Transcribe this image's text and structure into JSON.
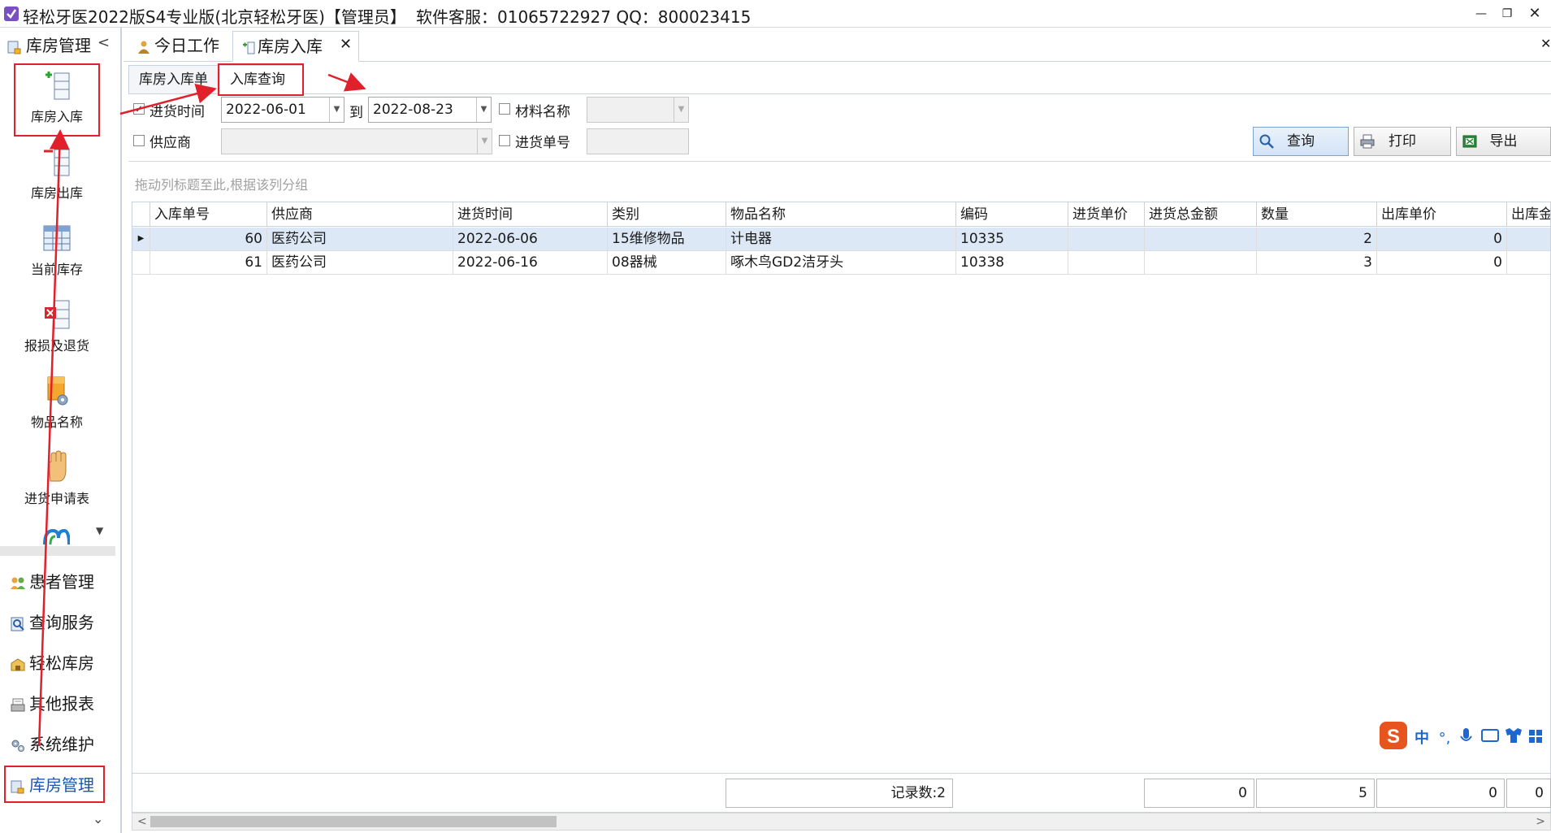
{
  "window": {
    "title": "轻松牙医2022版S4专业版(北京轻松牙医)【管理员】",
    "service": "软件客服：01065722927 QQ：800023415"
  },
  "sidebar": {
    "header": "库房管理",
    "tools": [
      {
        "label": "库房入库",
        "icon": "inbound-icon"
      },
      {
        "label": "库房出库",
        "icon": "outbound-icon"
      },
      {
        "label": "当前库存",
        "icon": "inventory-icon"
      },
      {
        "label": "报损及退货",
        "icon": "damage-return-icon"
      },
      {
        "label": "物品名称",
        "icon": "item-name-icon"
      },
      {
        "label": "进货申请表",
        "icon": "purchase-request-icon"
      }
    ],
    "nav": [
      {
        "label": "患者管理",
        "icon": "patients-icon"
      },
      {
        "label": "查询服务",
        "icon": "query-service-icon"
      },
      {
        "label": "轻松库房",
        "icon": "warehouse-icon"
      },
      {
        "label": "其他报表",
        "icon": "reports-icon"
      },
      {
        "label": "系统维护",
        "icon": "maintenance-icon"
      },
      {
        "label": "库房管理",
        "icon": "warehouse-manage-icon"
      }
    ]
  },
  "tabs": {
    "today": "今日工作",
    "inbound": "库房入库"
  },
  "subtabs": {
    "entry": "库房入库单",
    "query": "入库查询"
  },
  "filters": {
    "date_label": "进货时间",
    "date_checked": true,
    "date_from": "2022-06-01",
    "to_label": "到",
    "date_to": "2022-08-23",
    "material_label": "材料名称",
    "material_checked": false,
    "material_value": "",
    "supplier_label": "供应商",
    "supplier_checked": false,
    "supplier_value": "",
    "order_no_label": "进货单号",
    "order_no_checked": false,
    "order_no_value": ""
  },
  "buttons": {
    "query": "查询",
    "print": "打印",
    "export": "导出"
  },
  "grid": {
    "group_hint": "拖动列标题至此,根据该列分组",
    "columns": [
      "入库单号",
      "供应商",
      "进货时间",
      "类别",
      "物品名称",
      "编码",
      "进货单价",
      "进货总金额",
      "数量",
      "出库单价",
      "出库金"
    ],
    "rows": [
      [
        "60",
        "医药公司",
        "2022-06-06",
        "15维修物品",
        "计电器",
        "10335",
        "",
        "",
        "2",
        "0",
        ""
      ],
      [
        "61",
        "医药公司",
        "2022-06-16",
        "08器械",
        "啄木鸟GD2洁牙头",
        "10338",
        "",
        "",
        "3",
        "0",
        ""
      ]
    ],
    "footer": {
      "record_count": "记录数:2",
      "total_amount": "0",
      "total_qty": "5",
      "out_price": "0",
      "out_amount": "0"
    }
  },
  "ime": {
    "logo": "S",
    "mode": "中"
  },
  "colors": {
    "annotation": "#e0202a",
    "selected_row": "#dde8f6",
    "border": "#c9d3df"
  }
}
